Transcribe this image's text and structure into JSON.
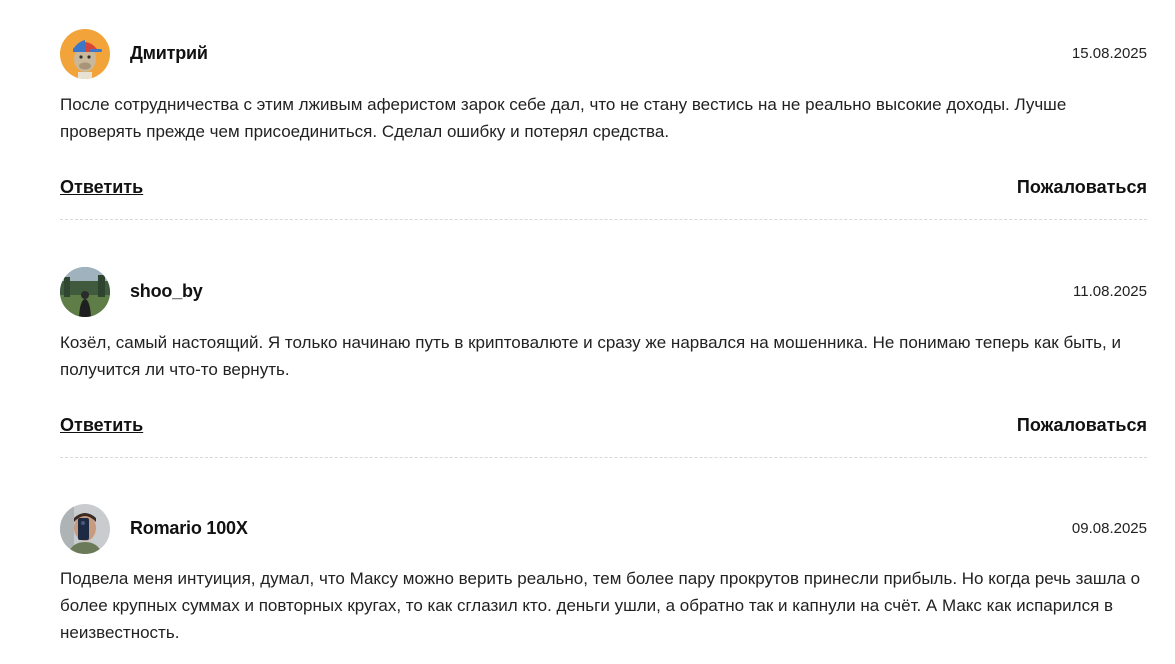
{
  "comments": [
    {
      "author": "Дмитрий",
      "date": "15.08.2025",
      "text": "После сотрудничества с этим лживым аферистом зарок себе дал, что не стану вестись на не реально высокие доходы. Лучше проверять прежде чем присоединиться. Сделал ошибку и потерял средства.",
      "reply_label": "Ответить",
      "report_label": "Пожаловаться"
    },
    {
      "author": "shoo_by",
      "date": "11.08.2025",
      "text": "Козёл, самый настоящий. Я только начинаю путь в криптовалюте и сразу же нарвался на мошенника. Не понимаю теперь как быть, и получится ли что-то вернуть.",
      "reply_label": "Ответить",
      "report_label": "Пожаловаться"
    },
    {
      "author": "Romario 100X",
      "date": "09.08.2025",
      "text": "Подвела меня интуиция, думал, что Максу можно верить реально, тем более пару прокрутов принесли прибыль. Но когда речь зашла о более крупных суммах и повторных кругах, то как сглазил кто. деньги ушли, а обратно так и капнули на счёт. А Макс как испарился в неизвестность."
    }
  ]
}
